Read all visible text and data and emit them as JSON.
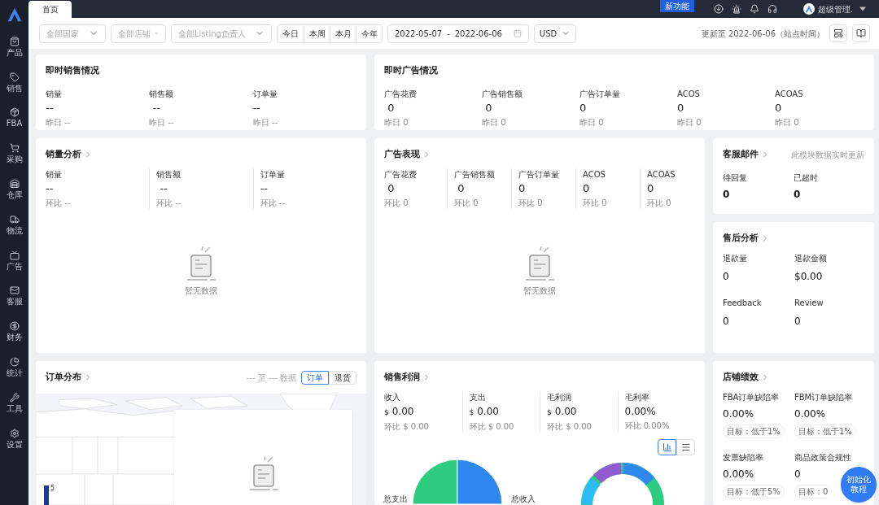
{
  "sidebar": {
    "items": [
      {
        "label": "产品"
      },
      {
        "label": "销售"
      },
      {
        "label": "FBA"
      },
      {
        "label": "采购"
      },
      {
        "label": "仓库"
      },
      {
        "label": "物流"
      },
      {
        "label": "广告"
      },
      {
        "label": "客服"
      },
      {
        "label": "财务"
      },
      {
        "label": "统计"
      },
      {
        "label": "工具"
      },
      {
        "label": "设置"
      }
    ]
  },
  "tabs": [
    {
      "label": "首页",
      "selected": true
    }
  ],
  "header": {
    "new_feature_badge": "新功能",
    "user": "超级管理."
  },
  "filters": {
    "country": {
      "placeholder": "全部国家"
    },
    "store": {
      "placeholder": "全部店铺"
    },
    "owner": {
      "placeholder": "全部Listing负责人"
    },
    "periods": [
      {
        "label": "今日",
        "selected": false
      },
      {
        "label": "本周",
        "selected": false
      },
      {
        "label": "本月",
        "selected": false
      },
      {
        "label": "今年",
        "selected": false
      }
    ],
    "date_start": "2022-05-07",
    "date_separator": "-",
    "date_end": "2022-06-06",
    "currency": "USD",
    "updated": "更新至 2022-06-06（站点时间）"
  },
  "realtime_sales": {
    "title": "即时销售情况",
    "metrics": [
      {
        "label": "销量",
        "value": "--",
        "sub": "昨日 --"
      },
      {
        "label": "销售额",
        "value": " --",
        "sub": "昨日 --"
      },
      {
        "label": "订单量",
        "value": "--",
        "sub": "昨日 --"
      }
    ]
  },
  "realtime_ads": {
    "title": "即时广告情况",
    "metrics": [
      {
        "label": "广告花费",
        "value": " 0",
        "sub": "昨日 0"
      },
      {
        "label": "广告销售额",
        "value": " 0",
        "sub": "昨日 0"
      },
      {
        "label": "广告订单量",
        "value": "0",
        "sub": "昨日 0"
      },
      {
        "label": "ACOS",
        "value": "0",
        "sub": "昨日 0"
      },
      {
        "label": "ACOAS",
        "value": "0",
        "sub": "昨日 0"
      }
    ]
  },
  "sales_analysis": {
    "title": "销量分析",
    "metrics": [
      {
        "label": "销量",
        "value": "--",
        "sub": "环比 --"
      },
      {
        "label": "销售额",
        "value": " --",
        "sub": "环比 --"
      },
      {
        "label": "订单量",
        "value": "--",
        "sub": "环比 --"
      }
    ],
    "empty": "暂无数据"
  },
  "ad_performance": {
    "title": "广告表现",
    "metrics": [
      {
        "label": "广告花费",
        "value": " 0",
        "sub": "环比 0"
      },
      {
        "label": "广告销售额",
        "value": " 0",
        "sub": "环比 0"
      },
      {
        "label": "广告订单量",
        "value": "0",
        "sub": "环比 0"
      },
      {
        "label": "ACOS",
        "value": "0",
        "sub": "环比 0"
      },
      {
        "label": "ACOAS",
        "value": "0",
        "sub": "环比 0"
      }
    ],
    "empty": "暂无数据"
  },
  "service_mail": {
    "title": "客服邮件",
    "note": "此模块数据实时更新",
    "metrics": [
      {
        "label": "待回复",
        "value": "0"
      },
      {
        "label": "已超时",
        "value": "0"
      }
    ]
  },
  "after_sales": {
    "title": "售后分析",
    "metrics": [
      {
        "label": "退款量",
        "value": "0"
      },
      {
        "label": "退款金额",
        "value": "$0.00"
      },
      {
        "label": "Feedback",
        "value": "0"
      },
      {
        "label": "Review",
        "value": "0"
      }
    ]
  },
  "order_distribution": {
    "title": "订单分布",
    "range": "--- 至 --- 数据",
    "toggles": [
      {
        "label": "订单",
        "selected": true
      },
      {
        "label": "退货",
        "selected": false
      }
    ],
    "legend_max": "5"
  },
  "profit": {
    "title": "销售利润",
    "metrics": [
      {
        "label": "收入",
        "currency": "$",
        "value": "0.00",
        "sub": "环比 $ 0.00"
      },
      {
        "label": "支出",
        "currency": "$",
        "value": "0.00",
        "sub": "环比 $ 0.00"
      },
      {
        "label": "毛利润",
        "currency": "$",
        "value": "0.00",
        "sub": "环比 $ 0.00"
      },
      {
        "label": "毛利率",
        "value": "0.00%",
        "sub": "环比 0.00%"
      }
    ],
    "view_toggles": [
      {
        "kind": "chart",
        "selected": true
      },
      {
        "kind": "list",
        "selected": false
      }
    ],
    "pie_label": "总支出",
    "donut_label": "总收入"
  },
  "store_performance": {
    "title": "店铺绩效",
    "metrics": [
      {
        "label": "FBA订单缺陷率",
        "value": "0.00%",
        "target": "目标：低于1%"
      },
      {
        "label": "FBM订单缺陷率",
        "value": "0.00%",
        "target": "目标：低于1%"
      },
      {
        "label": "发票缺陷率",
        "value": "0.00%",
        "target": "目标：低于5%"
      },
      {
        "label": "商品政策合规性",
        "value": "0",
        "target": "目标：0"
      }
    ]
  },
  "tutorial_button": "初始化教程"
}
